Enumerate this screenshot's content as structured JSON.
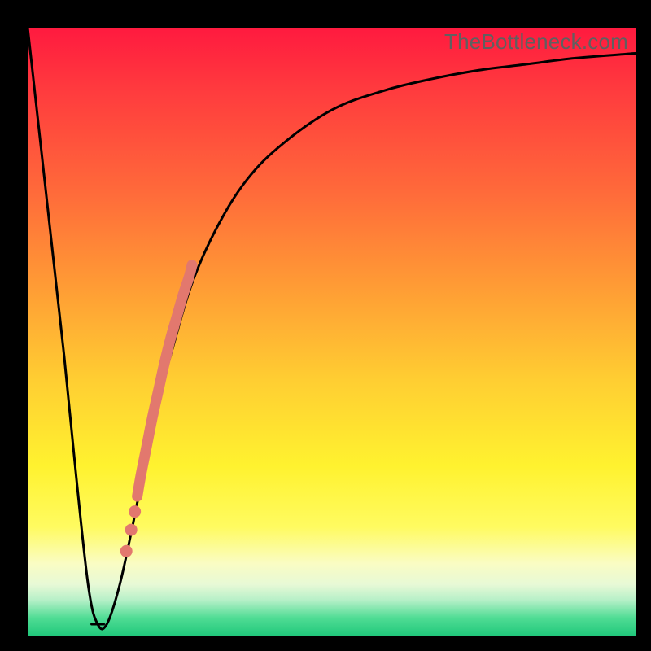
{
  "watermark": "TheBottleneck.com",
  "chart_data": {
    "type": "line",
    "title": "",
    "xlabel": "",
    "ylabel": "",
    "xlim": [
      0,
      100
    ],
    "ylim": [
      0,
      100
    ],
    "grid": false,
    "legend": false,
    "series": [
      {
        "name": "bottleneck-curve",
        "x": [
          0,
          3,
          6,
          8,
          10,
          11.5,
          13,
          15,
          17,
          19,
          21,
          24,
          27,
          31,
          36,
          42,
          50,
          58,
          66,
          74,
          82,
          90,
          100
        ],
        "y": [
          100,
          73,
          46,
          26,
          8,
          2,
          2,
          8,
          17,
          27,
          37,
          48,
          58,
          67,
          75,
          81,
          86.5,
          89.5,
          91.5,
          93,
          94,
          95,
          95.8
        ]
      }
    ],
    "dip_flat": {
      "x_start": 10.5,
      "x_end": 12.5,
      "y": 2
    },
    "highlight_band": {
      "name": "salmon-overlay",
      "color": "#e2786e",
      "x": [
        18.0,
        18.6,
        19.5,
        20.5,
        21.5,
        22.5,
        23.5,
        24.5,
        25.5,
        26.5,
        27.0
      ],
      "y": [
        23.0,
        26.5,
        31.0,
        36.0,
        40.5,
        45.0,
        49.0,
        52.5,
        56.0,
        59.0,
        61.0
      ]
    },
    "dots": {
      "name": "salmon-dots",
      "color": "#e2786e",
      "points": [
        {
          "x": 16.2,
          "y": 14.0
        },
        {
          "x": 17.0,
          "y": 17.5
        },
        {
          "x": 17.6,
          "y": 20.5
        }
      ]
    }
  }
}
